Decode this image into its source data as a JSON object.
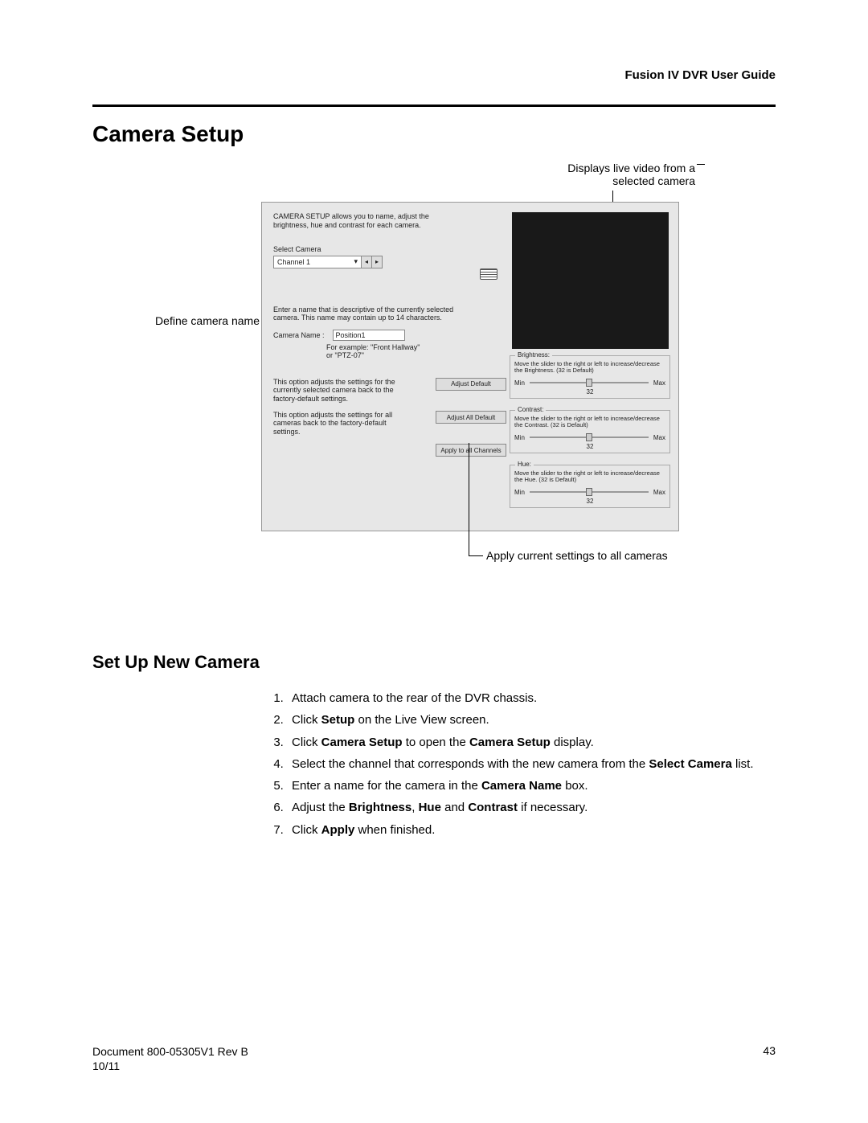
{
  "doc_header": "Fusion IV DVR User Guide",
  "title": "Camera Setup",
  "subsection": "Set Up New Camera",
  "callouts": {
    "top_right_l1": "Displays live video from a",
    "top_right_l2": "selected camera",
    "left": "Define camera name",
    "bottom": "Apply current settings to all cameras"
  },
  "panel": {
    "intro": "CAMERA SETUP allows you to name, adjust the brightness, hue and contrast for each camera.",
    "select_label": "Select Camera",
    "combo_value": "Channel 1",
    "name_help": "Enter a name that is descriptive of the currently selected camera. This name may contain up to 14 characters.",
    "camera_name_label": "Camera Name :",
    "camera_name_value": "Position1",
    "example_l1": "For example:  \"Front Hallway\"",
    "example_l2": "or \"PTZ-07\"",
    "adjust_default_text": "This option adjusts the settings for the currently selected camera back to the factory-default settings.",
    "adjust_default_btn": "Adjust Default",
    "adjust_all_text": "This option adjusts the settings for all cameras back to the factory-default settings.",
    "adjust_all_btn": "Adjust All Default",
    "apply_all_btn": "Apply to all Channels",
    "sliders": {
      "brightness": {
        "title": "Brightness:",
        "desc": "Move the slider to the right or left to increase/decrease the Brightness. (32 is Default)",
        "min": "Min",
        "max": "Max",
        "value": "32"
      },
      "contrast": {
        "title": "Contrast:",
        "desc": "Move the slider to the right or left to increase/decrease the Contrast. (32 is Default)",
        "min": "Min",
        "max": "Max",
        "value": "32"
      },
      "hue": {
        "title": "Hue:",
        "desc": "Move the slider to the right or left to increase/decrease the Hue. (32 is Default)",
        "min": "Min",
        "max": "Max",
        "value": "32"
      }
    }
  },
  "steps": {
    "s1": "Attach camera to the rear of the DVR chassis.",
    "s2a": "Click ",
    "s2b": "Setup",
    "s2c": " on the Live View screen.",
    "s3a": "Click ",
    "s3b": "Camera Setup",
    "s3c": " to open the ",
    "s3d": "Camera Setup",
    "s3e": " display.",
    "s4a": "Select the channel that corresponds with the new camera from the ",
    "s4b": "Select Camera",
    "s4c": " list.",
    "s5a": "Enter a name for the camera in the ",
    "s5b": "Camera Name",
    "s5c": " box.",
    "s6a": "Adjust the ",
    "s6b": "Brightness",
    "s6c": ", ",
    "s6d": "Hue",
    "s6e": " and ",
    "s6f": "Contrast",
    "s6g": " if necessary.",
    "s7a": "Click ",
    "s7b": "Apply",
    "s7c": " when finished."
  },
  "footer": {
    "doc_id": "Document 800-05305V1 Rev B",
    "date": "10/11",
    "page": "43"
  }
}
